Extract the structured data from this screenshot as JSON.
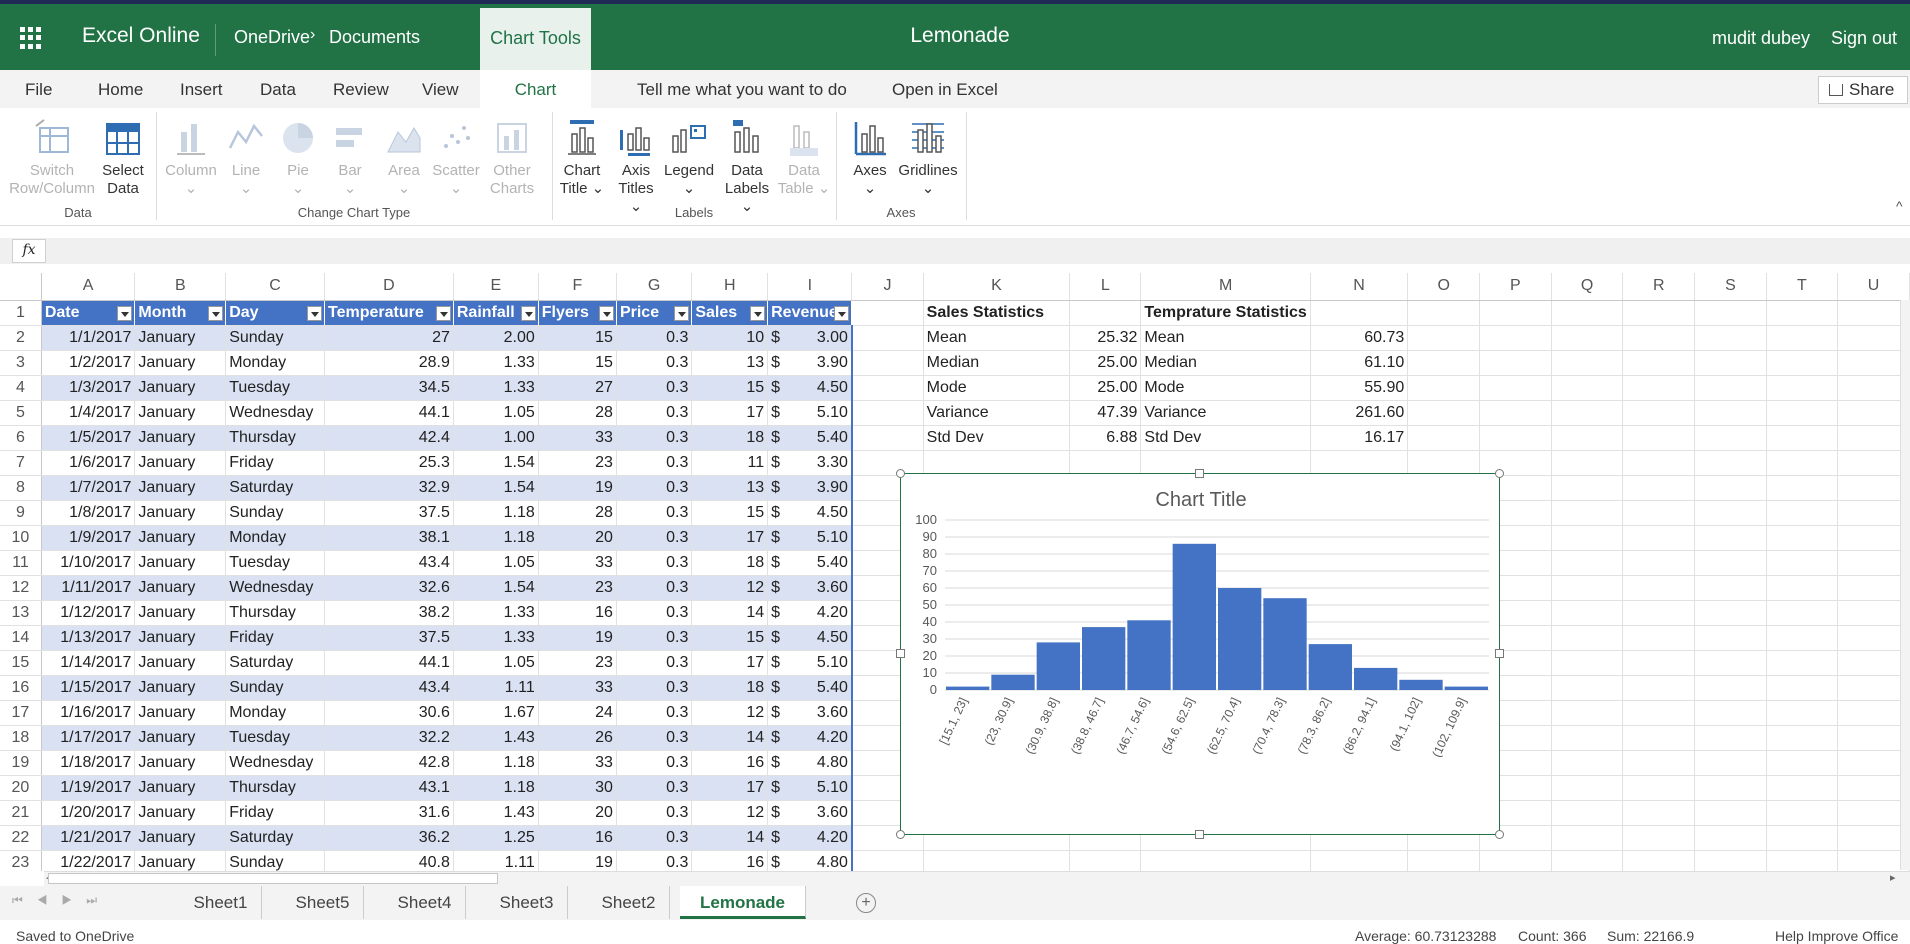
{
  "titlebar": {
    "app": "Excel Online",
    "crumb1": "OneDrive",
    "crumb_sep": "›",
    "crumb2": "Documents",
    "context_tab": "Chart Tools",
    "doc": "Lemonade",
    "user": "mudit dubey",
    "signout": "Sign out"
  },
  "menu": {
    "file": "File",
    "home": "Home",
    "insert": "Insert",
    "data": "Data",
    "review": "Review",
    "view": "View",
    "chart": "Chart",
    "tell": "Tell me what you want to do",
    "open": "Open in Excel",
    "share": "Share"
  },
  "ribbon": {
    "switch1": "Switch",
    "switch2": "Row/Column",
    "select1": "Select",
    "select2": "Data",
    "group_data": "Data",
    "column": "Column",
    "line": "Line",
    "pie": "Pie",
    "bar": "Bar",
    "area": "Area",
    "scatter": "Scatter",
    "other1": "Other",
    "other2": "Charts",
    "group_type": "Change Chart Type",
    "ctitle1": "Chart",
    "ctitle2": "Title",
    "axt1": "Axis",
    "axt2": "Titles",
    "legend": "Legend",
    "dl1": "Data",
    "dl2": "Labels",
    "dt1": "Data",
    "dt2": "Table",
    "group_labels": "Labels",
    "axes": "Axes",
    "gridlines": "Gridlines",
    "group_axes": "Axes"
  },
  "formula": {
    "fx": "fx"
  },
  "columns": [
    "A",
    "B",
    "C",
    "D",
    "E",
    "F",
    "G",
    "H",
    "I",
    "J",
    "K",
    "L",
    "M",
    "N",
    "O",
    "P",
    "Q",
    "R",
    "S",
    "T",
    "U"
  ],
  "headers": [
    "Date",
    "Month",
    "Day",
    "Temperature",
    "Rainfall",
    "Flyers",
    "Price",
    "Sales",
    "Revenue"
  ],
  "rows": [
    [
      "1/1/2017",
      "January",
      "Sunday",
      "27",
      "2.00",
      "15",
      "0.3",
      "10",
      "3.00"
    ],
    [
      "1/2/2017",
      "January",
      "Monday",
      "28.9",
      "1.33",
      "15",
      "0.3",
      "13",
      "3.90"
    ],
    [
      "1/3/2017",
      "January",
      "Tuesday",
      "34.5",
      "1.33",
      "27",
      "0.3",
      "15",
      "4.50"
    ],
    [
      "1/4/2017",
      "January",
      "Wednesday",
      "44.1",
      "1.05",
      "28",
      "0.3",
      "17",
      "5.10"
    ],
    [
      "1/5/2017",
      "January",
      "Thursday",
      "42.4",
      "1.00",
      "33",
      "0.3",
      "18",
      "5.40"
    ],
    [
      "1/6/2017",
      "January",
      "Friday",
      "25.3",
      "1.54",
      "23",
      "0.3",
      "11",
      "3.30"
    ],
    [
      "1/7/2017",
      "January",
      "Saturday",
      "32.9",
      "1.54",
      "19",
      "0.3",
      "13",
      "3.90"
    ],
    [
      "1/8/2017",
      "January",
      "Sunday",
      "37.5",
      "1.18",
      "28",
      "0.3",
      "15",
      "4.50"
    ],
    [
      "1/9/2017",
      "January",
      "Monday",
      "38.1",
      "1.18",
      "20",
      "0.3",
      "17",
      "5.10"
    ],
    [
      "1/10/2017",
      "January",
      "Tuesday",
      "43.4",
      "1.05",
      "33",
      "0.3",
      "18",
      "5.40"
    ],
    [
      "1/11/2017",
      "January",
      "Wednesday",
      "32.6",
      "1.54",
      "23",
      "0.3",
      "12",
      "3.60"
    ],
    [
      "1/12/2017",
      "January",
      "Thursday",
      "38.2",
      "1.33",
      "16",
      "0.3",
      "14",
      "4.20"
    ],
    [
      "1/13/2017",
      "January",
      "Friday",
      "37.5",
      "1.33",
      "19",
      "0.3",
      "15",
      "4.50"
    ],
    [
      "1/14/2017",
      "January",
      "Saturday",
      "44.1",
      "1.05",
      "23",
      "0.3",
      "17",
      "5.10"
    ],
    [
      "1/15/2017",
      "January",
      "Sunday",
      "43.4",
      "1.11",
      "33",
      "0.3",
      "18",
      "5.40"
    ],
    [
      "1/16/2017",
      "January",
      "Monday",
      "30.6",
      "1.67",
      "24",
      "0.3",
      "12",
      "3.60"
    ],
    [
      "1/17/2017",
      "January",
      "Tuesday",
      "32.2",
      "1.43",
      "26",
      "0.3",
      "14",
      "4.20"
    ],
    [
      "1/18/2017",
      "January",
      "Wednesday",
      "42.8",
      "1.18",
      "33",
      "0.3",
      "16",
      "4.80"
    ],
    [
      "1/19/2017",
      "January",
      "Thursday",
      "43.1",
      "1.18",
      "30",
      "0.3",
      "17",
      "5.10"
    ],
    [
      "1/20/2017",
      "January",
      "Friday",
      "31.6",
      "1.43",
      "20",
      "0.3",
      "12",
      "3.60"
    ],
    [
      "1/21/2017",
      "January",
      "Saturday",
      "36.2",
      "1.25",
      "16",
      "0.3",
      "14",
      "4.20"
    ],
    [
      "1/22/2017",
      "January",
      "Sunday",
      "40.8",
      "1.11",
      "19",
      "0.3",
      "16",
      "4.80"
    ]
  ],
  "currency": "$",
  "sales_stats": {
    "title": "Sales Statistics",
    "rows": [
      [
        "Mean",
        "25.32"
      ],
      [
        "Median",
        "25.00"
      ],
      [
        "Mode",
        "25.00"
      ],
      [
        "Variance",
        "47.39"
      ],
      [
        "Std Dev",
        "6.88"
      ]
    ]
  },
  "temp_stats": {
    "title": "Temprature Statistics",
    "rows": [
      [
        "Mean",
        "60.73"
      ],
      [
        "Median",
        "61.10"
      ],
      [
        "Mode",
        "55.90"
      ],
      [
        "Variance",
        "261.60"
      ],
      [
        "Std Dev",
        "16.17"
      ]
    ]
  },
  "chart_data": {
    "type": "bar",
    "title": "Chart Title",
    "categories": [
      "[15.1, 23]",
      "(23, 30.9]",
      "(30.9, 38.8]",
      "(38.8, 46.7]",
      "(46.7, 54.6]",
      "(54.6, 62.5]",
      "(62.5, 70.4]",
      "(70.4, 78.3]",
      "(78.3, 86.2]",
      "(86.2, 94.1]",
      "(94.1, 102]",
      "(102, 109.9]"
    ],
    "values": [
      2,
      9,
      28,
      37,
      41,
      86,
      60,
      54,
      27,
      13,
      6,
      2
    ],
    "ylim": [
      0,
      100
    ],
    "yticks": [
      0,
      10,
      20,
      30,
      40,
      50,
      60,
      70,
      80,
      90,
      100
    ],
    "color": "#4472c4",
    "grid": true
  },
  "sheets": [
    "Sheet1",
    "Sheet5",
    "Sheet4",
    "Sheet3",
    "Sheet2",
    "Lemonade"
  ],
  "active_sheet": "Lemonade",
  "status": {
    "saved": "Saved to OneDrive",
    "average": "Average: 60.73123288",
    "count": "Count: 366",
    "sum": "Sum: 22166.9",
    "help": "Help Improve Office"
  }
}
